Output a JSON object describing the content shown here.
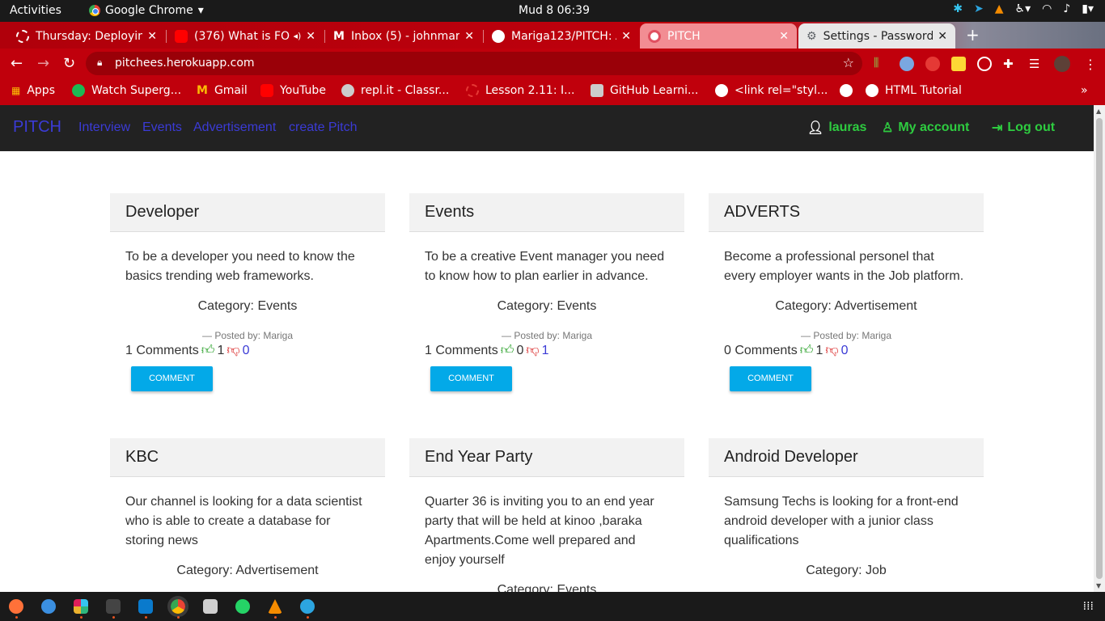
{
  "topbar": {
    "activities": "Activities",
    "app_name": "Google Chrome",
    "clock": "Mud 8  06:39"
  },
  "tabs": [
    {
      "label": "Thursday: Deployin",
      "icon_color": "#e53935"
    },
    {
      "label": "(376) What is FO",
      "icon_color": "#ff0000"
    },
    {
      "label": "Inbox (5) - johnmar",
      "icon_color": "#ea4335"
    },
    {
      "label": "Mariga123/PITCH: A",
      "icon_color": "#222222"
    },
    {
      "label": "PITCH",
      "icon_color": "#ffffff"
    },
    {
      "label": "Settings - Password",
      "icon_color": "#5f6368"
    }
  ],
  "address": {
    "url": "pitchees.herokuapp.com"
  },
  "bookmarks": [
    {
      "label": "Apps",
      "icon": "apps-grid-icon",
      "color": "#fbbc05"
    },
    {
      "label": "Watch Superg...",
      "icon": "play-icon",
      "color": "#1db954"
    },
    {
      "label": "Gmail",
      "icon": "gmail-icon",
      "color": "#ea4335"
    },
    {
      "label": "YouTube",
      "icon": "youtube-icon",
      "color": "#ff0000"
    },
    {
      "label": "repl.it - Classr...",
      "icon": "replit-icon",
      "color": "#cccccc"
    },
    {
      "label": "Lesson 2.11: I...",
      "icon": "lesson-icon",
      "color": "#e53935"
    },
    {
      "label": "GitHub Learni...",
      "icon": "github-icon",
      "color": "#cccccc"
    },
    {
      "label": "<link rel=\"styl...",
      "icon": "google-icon",
      "color": "#ffffff"
    },
    {
      "label": "",
      "icon": "globe-icon",
      "color": "#ffffff"
    },
    {
      "label": "HTML Tutorial",
      "icon": "globe-icon",
      "color": "#ffffff"
    }
  ],
  "site": {
    "brand": "PITCH",
    "nav": [
      "Interview",
      "Events",
      "Advertisement",
      "create Pitch"
    ],
    "user": "lauras",
    "my_account": "My account",
    "logout": "Log out"
  },
  "pitches": [
    {
      "title": "Developer",
      "body": "To be a developer you need to know the basics trending web frameworks.",
      "category": "Category: Events",
      "posted": "Posted by: Mariga",
      "comments": "1 Comments",
      "likes": "1",
      "dislikes": "0",
      "button": "COMMENT"
    },
    {
      "title": "Events",
      "body": "To be a creative Event manager you need to know how to plan earlier in advance.",
      "category": "Category: Events",
      "posted": "Posted by: Mariga",
      "comments": "1 Comments",
      "likes": "0",
      "dislikes": "1",
      "button": "COMMENT"
    },
    {
      "title": "ADVERTS",
      "body": "Become a professional personel that every employer wants in the Job platform.",
      "category": "Category: Advertisement",
      "posted": "Posted by: Mariga",
      "comments": "0 Comments",
      "likes": "1",
      "dislikes": "0",
      "button": "COMMENT"
    },
    {
      "title": "KBC",
      "body": "Our channel is looking for a data scientist who is able to create a database for storing news",
      "category": "Category: Advertisement"
    },
    {
      "title": "End Year Party",
      "body": "Quarter 36 is inviting you to an end year party that will be held at kinoo ,baraka Apartments.Come well prepared and enjoy yourself",
      "category": "Category: Events"
    },
    {
      "title": "Android Developer",
      "body": "Samsung Techs is looking for a front-end android developer with a junior class qualifications",
      "category": "Category: Job"
    }
  ],
  "dock": [
    {
      "icon": "firefox-icon",
      "color": "#ff7139"
    },
    {
      "icon": "help-icon",
      "color": "#3b8fe0"
    },
    {
      "icon": "slack-icon",
      "color": "#e01e5a"
    },
    {
      "icon": "terminal-icon",
      "color": "#444444"
    },
    {
      "icon": "vscode-icon",
      "color": "#0a7acc"
    },
    {
      "icon": "chrome-icon",
      "color": "#4285f4"
    },
    {
      "icon": "files-icon",
      "color": "#d0d0d0"
    },
    {
      "icon": "whatsapp-icon",
      "color": "#25d366"
    },
    {
      "icon": "vlc-icon",
      "color": "#f48b00"
    },
    {
      "icon": "telegram-icon",
      "color": "#2ca5e0"
    }
  ]
}
